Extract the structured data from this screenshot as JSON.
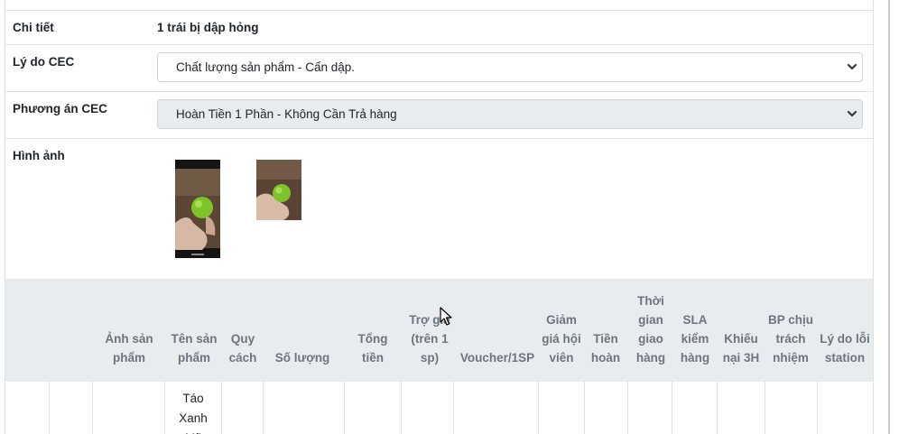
{
  "details": {
    "chi_tiet_label": "Chi tiết",
    "chi_tiet_value": "1 trái bị dập hỏng",
    "ly_do_label": "Lý do CEC",
    "ly_do_value": "Chất lượng sản phẩm - Cấn dập.",
    "phuong_an_label": "Phương án CEC",
    "phuong_an_value": "Hoàn Tiền 1 Phần - Không Cần Trả hàng",
    "hinh_anh_label": "Hình ảnh"
  },
  "table": {
    "headers": [
      "Ảnh sản phẩm",
      "Tên sản phẩm",
      "Quy cách",
      "Số lượng",
      "Tổng tiền",
      "Trợ giá (trên 1 sp)",
      "Voucher/1SP",
      "Giảm giá hội viên",
      "Tiền hoàn",
      "Thời gian giao hàng",
      "SLA kiểm hàng",
      "Khiếu nại 3H",
      "BP chịu trách nhiệm",
      "Lý do lỗi station"
    ],
    "first_row_product": "Táo Xanh Mỹ"
  },
  "colors": {
    "header_bg": "#e9ecef",
    "border": "#dee2e6",
    "apple_green": "#7cc42a"
  },
  "icons": [
    "chevron-down-icon",
    "mouse-cursor-icon"
  ]
}
